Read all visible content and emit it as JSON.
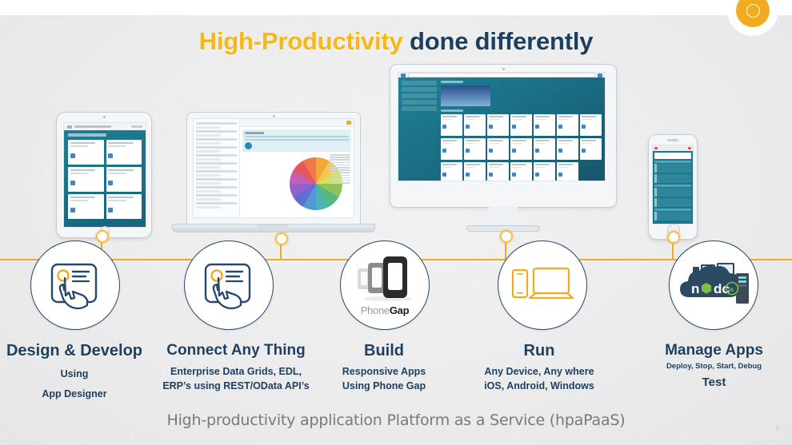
{
  "slide": {
    "title": {
      "highlight": "High-Productivity",
      "rest": " done differently"
    },
    "footer": "High-productivity application Platform as a Service (hpaPaaS)",
    "page_number": "3",
    "logo_icon": "orange-ring-logo",
    "colors": {
      "accent_orange": "#f0ab21",
      "title_orange": "#f7b718",
      "navy": "#1d3f5e",
      "circle_outline": "#27486a",
      "background": "#ececed",
      "footer_text": "#78797b",
      "teal_app": "#18788f"
    }
  },
  "devices": [
    {
      "name": "tablet",
      "icon": "tablet-device"
    },
    {
      "name": "laptop",
      "icon": "laptop-device"
    },
    {
      "name": "monitor",
      "icon": "desktop-monitor-device"
    },
    {
      "name": "phone",
      "icon": "smartphone-device"
    }
  ],
  "steps": [
    {
      "id": "design-develop",
      "icon": "hand-tap-screen-icon",
      "heading": "Design & Develop",
      "lines": [
        "Using",
        "App Designer"
      ]
    },
    {
      "id": "connect-any-thing",
      "icon": "hand-tap-screen-icon",
      "heading": "Connect Any Thing",
      "lines": [
        "Enterprise Data Grids, EDL,",
        "ERP’s using REST/OData API’s"
      ]
    },
    {
      "id": "build",
      "icon": "phonegap-logo-icon",
      "icon_text": {
        "light": "Phone",
        "bold": "Gap"
      },
      "heading": "Build",
      "lines": [
        "Responsive Apps",
        "Using Phone Gap"
      ]
    },
    {
      "id": "run",
      "icon": "phone-and-laptop-icon",
      "heading": "Run",
      "lines": [
        "Any Device, Any where",
        "iOS, Android, Windows"
      ]
    },
    {
      "id": "manage-apps",
      "icon": "nodejs-cloud-icon",
      "icon_text": "node",
      "heading": "Manage Apps",
      "lines": [
        "Deploy,  Stop,  Start, Debug",
        "Test"
      ]
    }
  ]
}
